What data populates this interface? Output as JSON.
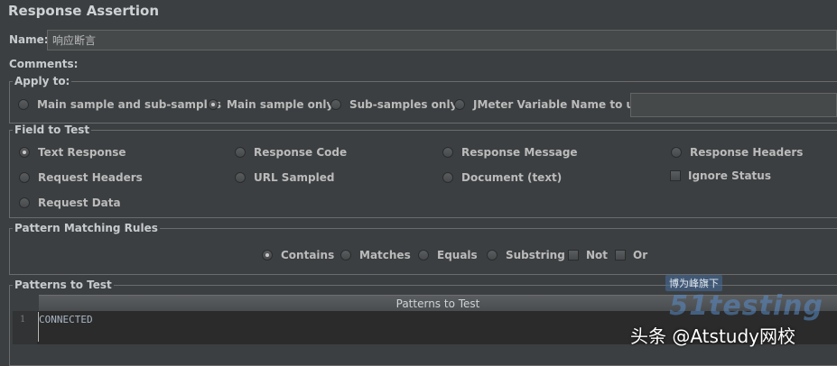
{
  "panel_title": "Response Assertion",
  "name": {
    "label": "Name:",
    "value": "响应断言"
  },
  "comments": {
    "label": "Comments:",
    "value": ""
  },
  "apply_to": {
    "legend": "Apply to:",
    "options": [
      "Main sample and sub-samples",
      "Main sample only",
      "Sub-samples only",
      "JMeter Variable Name to use"
    ],
    "selected": "Main sample only",
    "variable_value": ""
  },
  "field_to_test": {
    "legend": "Field to Test",
    "options": [
      "Text Response",
      "Response Code",
      "Response Message",
      "Response Headers",
      "Request Headers",
      "URL Sampled",
      "Document (text)",
      "Request Data"
    ],
    "selected": "Text Response",
    "ignore_status": {
      "label": "Ignore Status",
      "checked": false
    }
  },
  "pattern_matching_rules": {
    "legend": "Pattern Matching Rules",
    "options": [
      "Contains",
      "Matches",
      "Equals",
      "Substring"
    ],
    "selected": "Contains",
    "checkboxes": [
      {
        "label": "Not",
        "checked": false
      },
      {
        "label": "Or",
        "checked": false
      }
    ]
  },
  "patterns_to_test": {
    "legend": "Patterns to Test",
    "column_header": "Patterns to Test",
    "rows": [
      {
        "line": "1",
        "pattern": "CONNECTED"
      }
    ]
  },
  "watermark": {
    "badge": "博为峰旗下",
    "brand": "51testing",
    "credit": "头条 @Atstudy网校"
  }
}
